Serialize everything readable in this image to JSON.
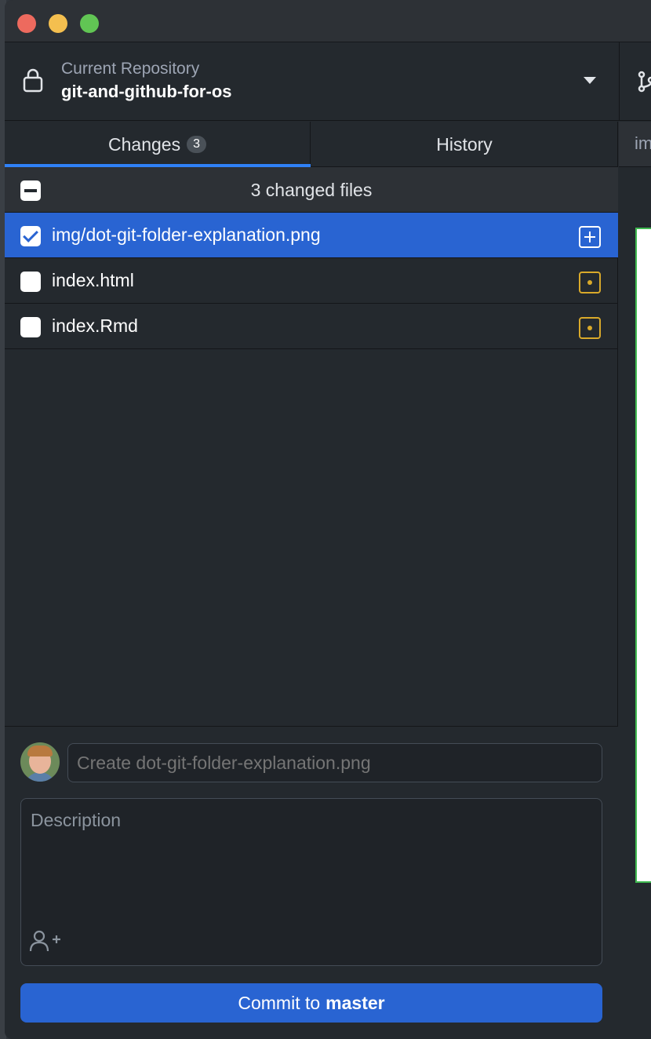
{
  "repository": {
    "label": "Current Repository",
    "name": "git-and-github-for-os"
  },
  "tabs": [
    {
      "label": "Changes",
      "count": "3",
      "active": true
    },
    {
      "label": "History",
      "active": false
    }
  ],
  "changes": {
    "header": "3 changed files",
    "files": [
      {
        "name": "img/dot-git-folder-explanation.png",
        "checked": true,
        "status": "added",
        "selected": true
      },
      {
        "name": "index.html",
        "checked": false,
        "status": "modified",
        "selected": false
      },
      {
        "name": "index.Rmd",
        "checked": false,
        "status": "modified",
        "selected": false
      }
    ]
  },
  "commit": {
    "summary_placeholder": "Create dot-git-folder-explanation.png",
    "description_placeholder": "Description",
    "button_prefix": "Commit to",
    "branch": "master"
  },
  "diff": {
    "tab_label": "im"
  },
  "colors": {
    "accent": "#2964d2",
    "added": "#ffffff",
    "modified": "#d9a92a"
  }
}
